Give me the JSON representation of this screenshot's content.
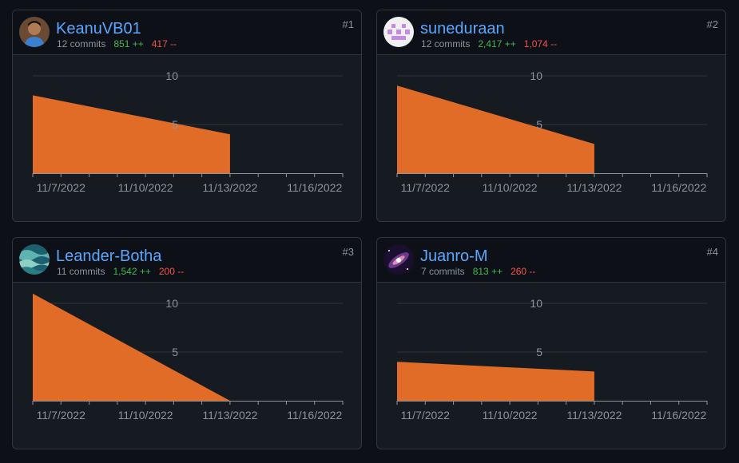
{
  "theme": {
    "background": "#0d1117",
    "card_background": "#161b22",
    "border": "#30363d",
    "link": "#58a6ff",
    "additions": "#3fb950",
    "deletions": "#f85149",
    "area_fill": "#e06c27",
    "muted": "#8b949e"
  },
  "contributors": [
    {
      "rank": "#1",
      "username": "KeanuVB01",
      "commits": "12 commits",
      "additions": "851 ++",
      "deletions": "417 --",
      "avatar_icon": "avatar-photo-icon",
      "chart_data": {
        "type": "area",
        "x": [
          "11/6/2022",
          "11/13/2022"
        ],
        "values": [
          8,
          4
        ],
        "xticks": [
          "11/7/2022",
          "11/10/2022",
          "11/13/2022",
          "11/16/2022"
        ],
        "yticks": [
          "10",
          "5"
        ],
        "ylim": [
          0,
          10
        ],
        "grid": true
      }
    },
    {
      "rank": "#2",
      "username": "suneduraan",
      "commits": "12 commits",
      "additions": "2,417 ++",
      "deletions": "1,074 --",
      "avatar_icon": "identicon-avatar-icon",
      "chart_data": {
        "type": "area",
        "x": [
          "11/6/2022",
          "11/13/2022"
        ],
        "values": [
          9,
          3
        ],
        "xticks": [
          "11/7/2022",
          "11/10/2022",
          "11/13/2022",
          "11/16/2022"
        ],
        "yticks": [
          "10",
          "5"
        ],
        "ylim": [
          0,
          10
        ],
        "grid": true
      }
    },
    {
      "rank": "#3",
      "username": "Leander-Botha",
      "commits": "11 commits",
      "additions": "1,542 ++",
      "deletions": "200 --",
      "avatar_icon": "ocean-avatar-icon",
      "chart_data": {
        "type": "area",
        "x": [
          "11/6/2022",
          "11/13/2022"
        ],
        "values": [
          11,
          0
        ],
        "xticks": [
          "11/7/2022",
          "11/10/2022",
          "11/13/2022",
          "11/16/2022"
        ],
        "yticks": [
          "10",
          "5"
        ],
        "ylim": [
          0,
          10
        ],
        "grid": true
      }
    },
    {
      "rank": "#4",
      "username": "Juanro-M",
      "commits": "7 commits",
      "additions": "813 ++",
      "deletions": "260 --",
      "avatar_icon": "galaxy-avatar-icon",
      "chart_data": {
        "type": "area",
        "x": [
          "11/6/2022",
          "11/13/2022"
        ],
        "values": [
          4,
          3
        ],
        "xticks": [
          "11/7/2022",
          "11/10/2022",
          "11/13/2022",
          "11/16/2022"
        ],
        "yticks": [
          "10",
          "5"
        ],
        "ylim": [
          0,
          10
        ],
        "grid": true
      }
    }
  ]
}
